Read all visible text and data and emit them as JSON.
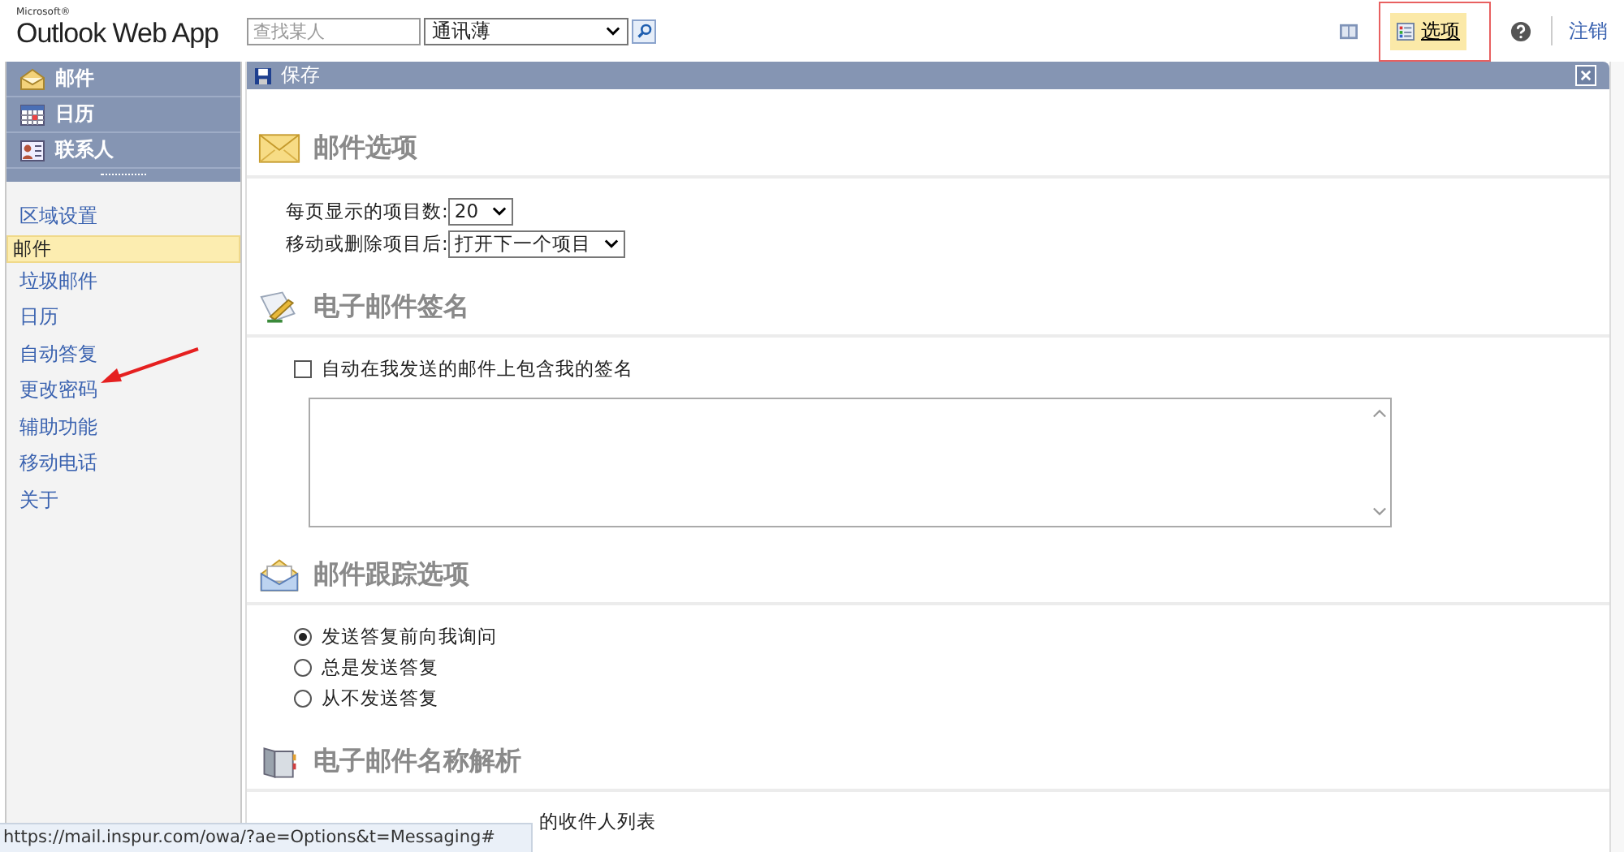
{
  "header": {
    "brand_small": "Microsoft®",
    "brand": "Outlook Web App",
    "search": {
      "placeholder": "查找某人"
    },
    "directory": {
      "value": "通讯薄"
    },
    "options_button": {
      "label": "选项",
      "selected": true
    },
    "signout": "注销"
  },
  "nav": {
    "modules": [
      {
        "label": "邮件"
      },
      {
        "label": "日历"
      },
      {
        "label": "联系人"
      }
    ],
    "items": [
      {
        "label": "区域设置",
        "selected": false
      },
      {
        "label": "邮件",
        "selected": true
      },
      {
        "label": "垃圾邮件",
        "selected": false
      },
      {
        "label": "日历",
        "selected": false
      },
      {
        "label": "自动答复",
        "selected": false
      },
      {
        "label": "更改密码",
        "selected": false
      },
      {
        "label": "辅助功能",
        "selected": false
      },
      {
        "label": "移动电话",
        "selected": false
      },
      {
        "label": "关于",
        "selected": false
      }
    ]
  },
  "toolbar": {
    "save": "保存"
  },
  "sections": [
    {
      "title": "邮件选项",
      "rows": [
        {
          "kind": "select",
          "label": "每页显示的项目数:",
          "value": "20"
        },
        {
          "kind": "select",
          "label": "移动或删除项目后:",
          "value": "打开下一个项目"
        }
      ]
    },
    {
      "title": "电子邮件签名",
      "rows": [
        {
          "kind": "checkbox",
          "label": "自动在我发送的邮件上包含我的签名",
          "checked": false
        },
        {
          "kind": "textarea"
        }
      ]
    },
    {
      "title": "邮件跟踪选项",
      "rows": [
        {
          "kind": "radio",
          "label": "发送答复前向我询问",
          "selected": true
        },
        {
          "kind": "radio",
          "label": "总是发送答复",
          "selected": false
        },
        {
          "kind": "radio",
          "label": "从不发送答复",
          "selected": false
        }
      ]
    },
    {
      "title": "电子邮件名称解析",
      "rows": [
        {
          "kind": "partial",
          "label": "的收件人列表"
        }
      ]
    }
  ],
  "status_url": "https://mail.inspur.com/owa/?ae=Options&t=Messaging#"
}
